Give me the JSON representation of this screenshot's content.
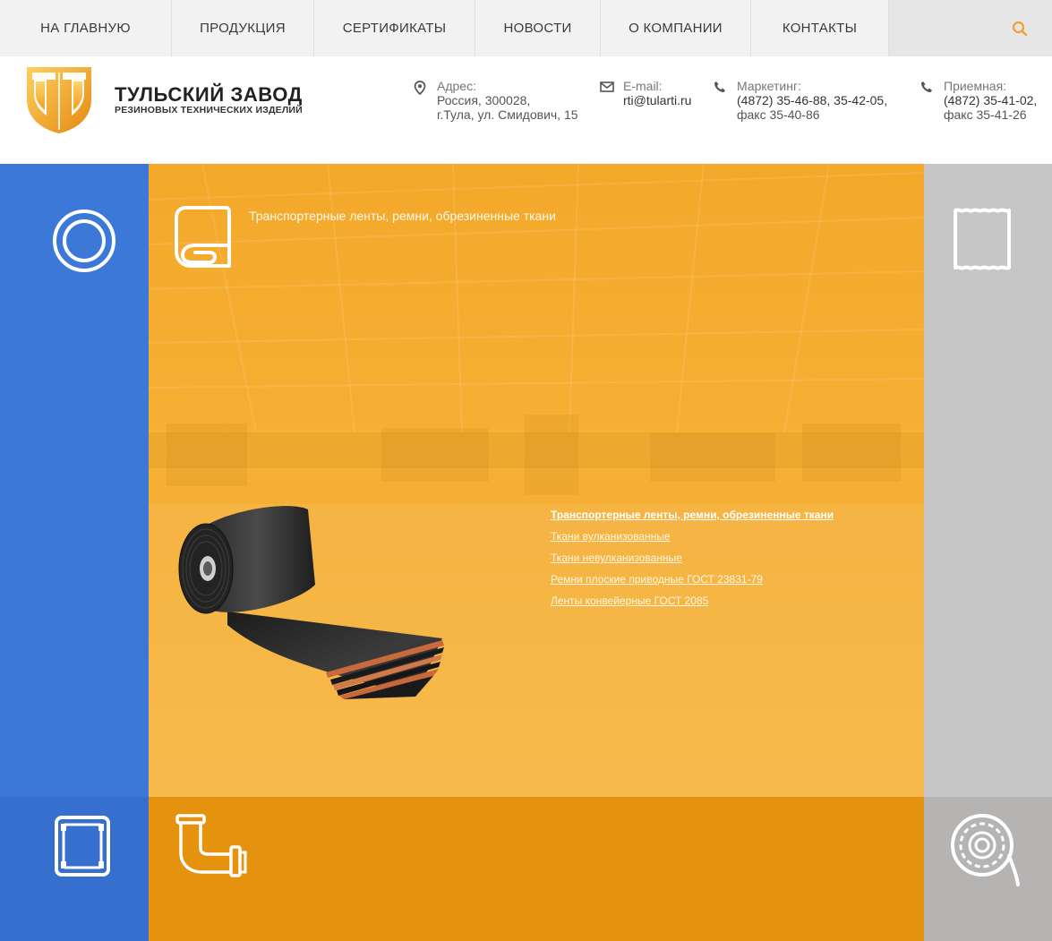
{
  "nav": {
    "items": [
      {
        "label": "НА ГЛАВНУЮ"
      },
      {
        "label": "ПРОДУКЦИЯ"
      },
      {
        "label": "СЕРТИФИКАТЫ"
      },
      {
        "label": "НОВОСТИ"
      },
      {
        "label": "О КОМПАНИИ"
      },
      {
        "label": "КОНТАКТЫ"
      }
    ],
    "search_icon": "search-icon"
  },
  "brand": {
    "title": "ТУЛЬСКИЙ ЗАВОД",
    "subtitle": "РЕЗИНОВЫХ ТЕХНИЧЕСКИХ ИЗДЕЛИЙ",
    "logo_icon": "tularti-logo"
  },
  "contacts": {
    "address": {
      "label": "Адрес:",
      "line1": "Россия, 300028,",
      "line2": "г.Тула, ул. Смидович, 15",
      "icon": "map-pin-icon"
    },
    "email": {
      "label": "E-mail:",
      "value": "rti@tularti.ru",
      "icon": "mail-icon"
    },
    "marketing": {
      "label": "Маркетинг:",
      "phones": "(4872) 35-46-88, 35-42-05,",
      "fax": "факс 35-40-86",
      "icon": "phone-icon"
    },
    "reception": {
      "label": "Приемная:",
      "phones": "(4872) 35-41-02,",
      "fax": "факс 35-41-26",
      "icon": "phone-icon"
    }
  },
  "catalog": {
    "section_title": "Транспортерные ленты, ремни, обрезиненные ткани",
    "links": [
      {
        "label": "Транспортерные ленты, ремни, обрезиненные ткани",
        "active": true
      },
      {
        "label": "Ткани вулканизованные"
      },
      {
        "label": "Ткани невулканизованные"
      },
      {
        "label": "Ремни плоские приводные ГОСТ 23831-79"
      },
      {
        "label": "Ленты конвейерные ГОСТ 2085"
      }
    ]
  },
  "tiles": {
    "blue_top_icon": "ring-icon",
    "orange_top_icon": "fabric-roll-icon",
    "grey_top_icon": "sheet-icon",
    "blue_bottom_icon": "frame-plate-icon",
    "orange_bottom_icon": "pipe-elbow-icon",
    "grey_bottom_icon": "hose-reel-icon"
  },
  "colors": {
    "blue": "#3c78d8",
    "orange": "#f5ae33",
    "orange_dark": "#e5930e",
    "grey": "#c6c6c6",
    "accent": "#f0a030"
  }
}
